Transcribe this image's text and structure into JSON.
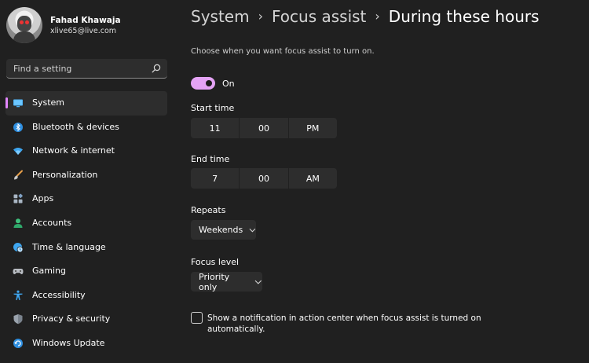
{
  "profile": {
    "name": "Fahad Khawaja",
    "email": "xlive65@live.com"
  },
  "search": {
    "placeholder": "Find a setting"
  },
  "sidebar": {
    "items": [
      {
        "label": "System",
        "icon": "monitor-icon",
        "selected": true
      },
      {
        "label": "Bluetooth & devices",
        "icon": "bluetooth-icon"
      },
      {
        "label": "Network & internet",
        "icon": "wifi-icon"
      },
      {
        "label": "Personalization",
        "icon": "brush-icon"
      },
      {
        "label": "Apps",
        "icon": "apps-icon"
      },
      {
        "label": "Accounts",
        "icon": "person-icon"
      },
      {
        "label": "Time & language",
        "icon": "globe-clock-icon"
      },
      {
        "label": "Gaming",
        "icon": "gamepad-icon"
      },
      {
        "label": "Accessibility",
        "icon": "accessibility-icon"
      },
      {
        "label": "Privacy & security",
        "icon": "shield-icon"
      },
      {
        "label": "Windows Update",
        "icon": "update-icon"
      }
    ]
  },
  "breadcrumb": {
    "system": "System",
    "focus_assist": "Focus assist",
    "current": "During these hours",
    "separator": "›"
  },
  "description": "Choose when you want focus assist to turn on.",
  "toggle": {
    "label": "On",
    "state": "on"
  },
  "start_time": {
    "label": "Start time",
    "hour": "11",
    "minute": "00",
    "period": "PM"
  },
  "end_time": {
    "label": "End time",
    "hour": "7",
    "minute": "00",
    "period": "AM"
  },
  "repeats": {
    "label": "Repeats",
    "value": "Weekends"
  },
  "focus_level": {
    "label": "Focus level",
    "value": "Priority only"
  },
  "notification_checkbox": {
    "label": "Show a notification in action center when focus assist is turned on automatically.",
    "checked": false
  },
  "colors": {
    "background": "#202020",
    "panel": "#2d2d2d",
    "accent": "#e4a3f5",
    "selection_bar": "#e387ff"
  }
}
